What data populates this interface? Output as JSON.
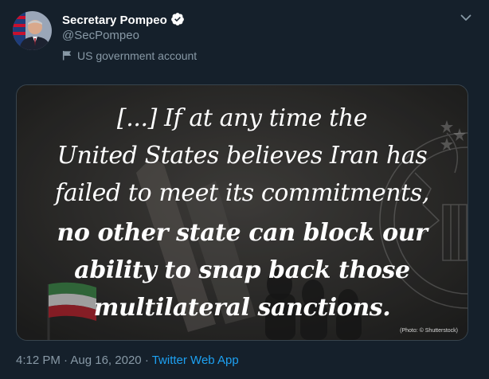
{
  "author": {
    "name": "Secretary Pompeo",
    "handle": "@SecPompeo",
    "label": "US government account"
  },
  "media": {
    "quote_lines": [
      "[...] If at any time the",
      "United States believes Iran has",
      "failed to meet its commitments,",
      "no other state can block our",
      "ability to snap back those",
      "multilateral sanctions."
    ],
    "photo_credit": "(Photo: © Shutterstock)"
  },
  "meta": {
    "time": "4:12 PM",
    "separator": "·",
    "date": "Aug 16, 2020",
    "source": "Twitter Web App"
  },
  "icons": {
    "verified": "verified-badge",
    "label_flag": "flag",
    "menu": "chevron-down"
  },
  "colors": {
    "background": "#15202b",
    "accent": "#1da1f2",
    "muted": "#8899a6"
  }
}
